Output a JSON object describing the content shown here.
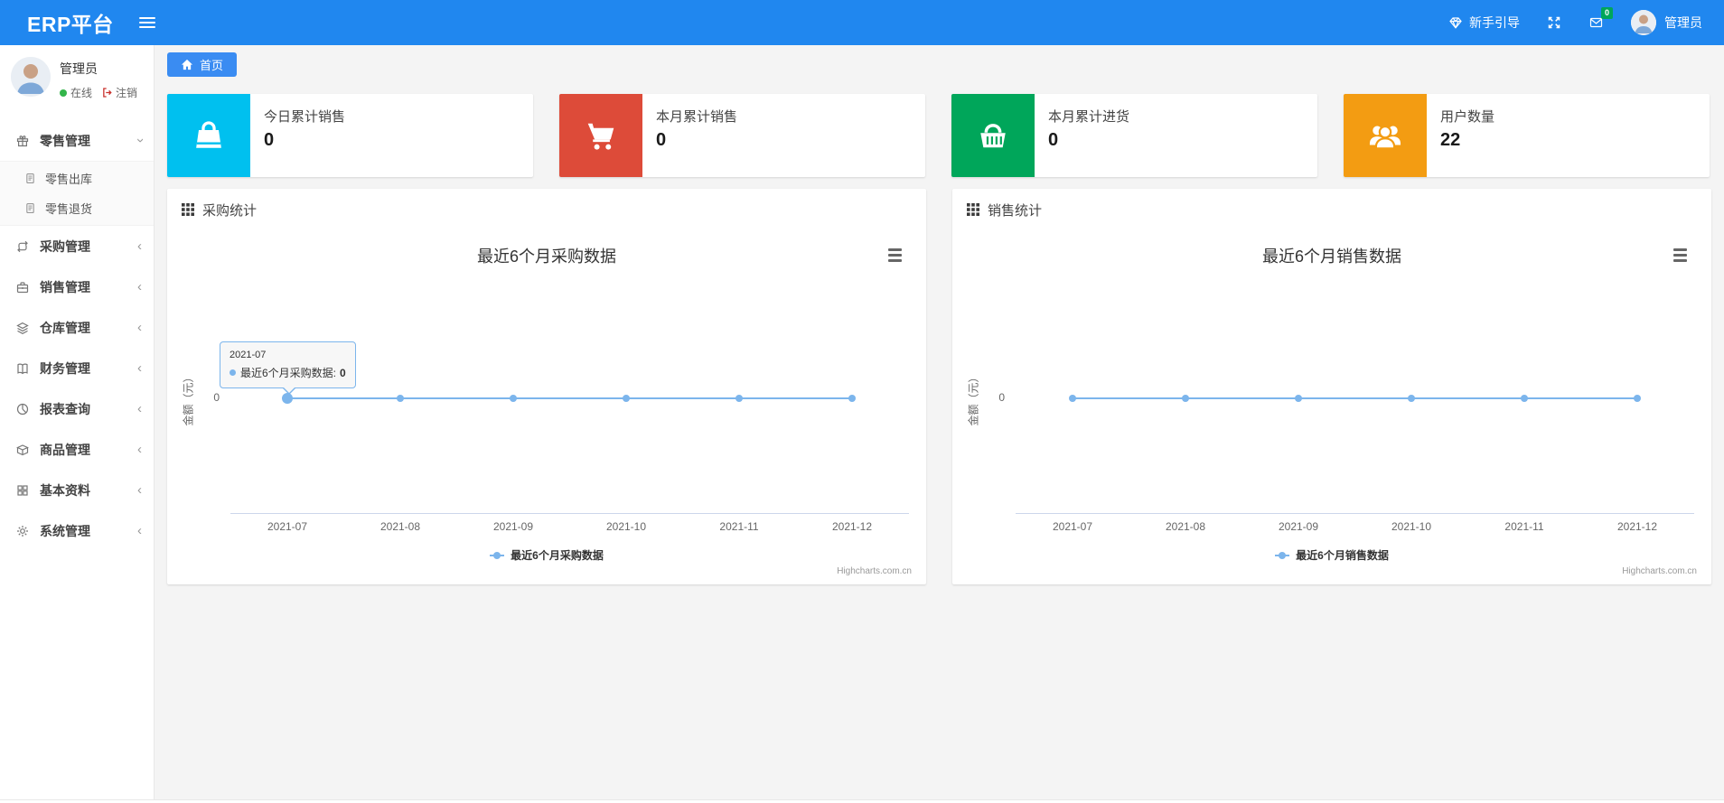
{
  "header": {
    "brand": "ERP平台",
    "guide_label": "新手引导",
    "mail_badge": "0",
    "username": "管理员",
    "colors": {
      "navbar": "#2087ef",
      "badge_green": "#00a65a"
    }
  },
  "sidebar": {
    "username": "管理员",
    "online_label": "在线",
    "logout_label": "注销",
    "items": [
      {
        "label": "零售管理",
        "icon": "gift-icon",
        "expanded": true
      },
      {
        "label": "零售出库",
        "icon": "file-icon",
        "submenu": true
      },
      {
        "label": "零售退货",
        "icon": "file-icon",
        "submenu": true
      },
      {
        "label": "采购管理",
        "icon": "repeat-icon"
      },
      {
        "label": "销售管理",
        "icon": "briefcase-icon"
      },
      {
        "label": "仓库管理",
        "icon": "layers-icon"
      },
      {
        "label": "财务管理",
        "icon": "book-icon"
      },
      {
        "label": "报表查询",
        "icon": "pie-chart-icon"
      },
      {
        "label": "商品管理",
        "icon": "box-icon"
      },
      {
        "label": "基本资料",
        "icon": "grid-icon"
      },
      {
        "label": "系统管理",
        "icon": "gear-icon"
      }
    ]
  },
  "breadcrumb": {
    "home": "首页"
  },
  "cards": [
    {
      "label": "今日累计销售",
      "value": "0",
      "color": "#00c0ef",
      "icon": "shopping-bag-icon"
    },
    {
      "label": "本月累计销售",
      "value": "0",
      "color": "#dd4b39",
      "icon": "shopping-cart-icon"
    },
    {
      "label": "本月累计进货",
      "value": "0",
      "color": "#00a65a",
      "icon": "shopping-basket-icon"
    },
    {
      "label": "用户数量",
      "value": "22",
      "color": "#f39c12",
      "icon": "users-icon"
    }
  ],
  "panels": [
    {
      "title": "采购统计"
    },
    {
      "title": "销售统计"
    }
  ],
  "chart_data": [
    {
      "type": "line",
      "title": "最近6个月采购数据",
      "categories": [
        "2021-07",
        "2021-08",
        "2021-09",
        "2021-10",
        "2021-11",
        "2021-12"
      ],
      "series": [
        {
          "name": "最近6个月采购数据",
          "values": [
            0,
            0,
            0,
            0,
            0,
            0
          ]
        }
      ],
      "ylabel": "金额（元）",
      "yticks": [
        "0"
      ],
      "ylim": [
        -1,
        1
      ],
      "grid": false,
      "legend_position": "bottom",
      "line_color": "#7cb5ec",
      "credit": "Highcharts.com.cn",
      "tooltip": {
        "header": "2021-07",
        "text": "最近6个月采购数据:",
        "value": "0"
      }
    },
    {
      "type": "line",
      "title": "最近6个月销售数据",
      "categories": [
        "2021-07",
        "2021-08",
        "2021-09",
        "2021-10",
        "2021-11",
        "2021-12"
      ],
      "series": [
        {
          "name": "最近6个月销售数据",
          "values": [
            0,
            0,
            0,
            0,
            0,
            0
          ]
        }
      ],
      "ylabel": "金额（元）",
      "yticks": [
        "0"
      ],
      "ylim": [
        -1,
        1
      ],
      "grid": false,
      "legend_position": "bottom",
      "line_color": "#7cb5ec",
      "credit": "Highcharts.com.cn"
    }
  ]
}
